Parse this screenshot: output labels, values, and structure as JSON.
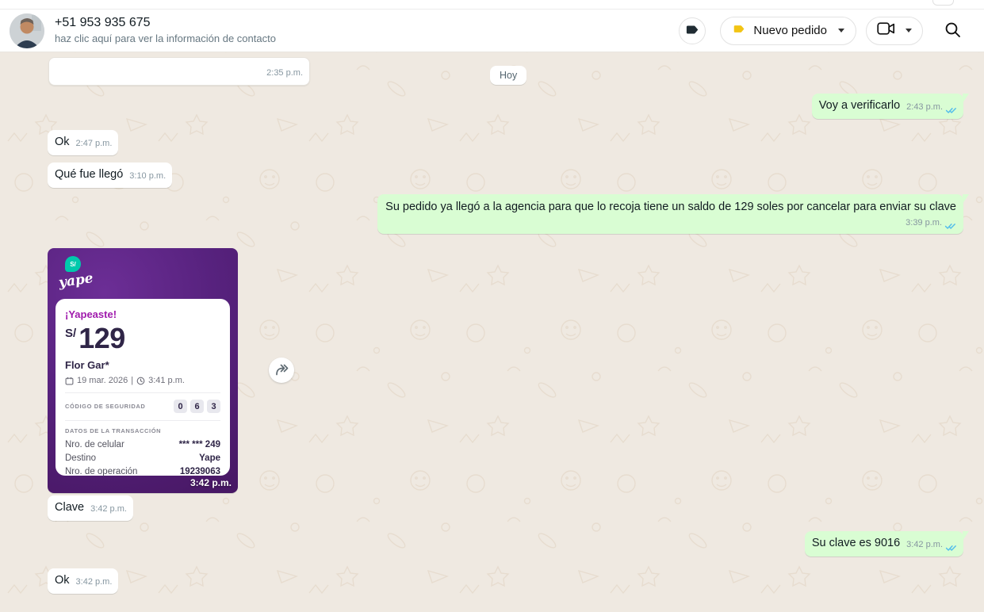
{
  "header": {
    "title": "+51 953 935 675",
    "subtitle": "haz clic aquí para ver la información de contacto",
    "status_button": {
      "label": "Nuevo pedido",
      "tag_color": "#f2c414"
    },
    "icons": [
      "tag-icon",
      "video-camera-icon",
      "chevron-down-icon",
      "search-icon"
    ]
  },
  "chat": {
    "date_divider": "Hoy",
    "messages": [
      {
        "direction": "in",
        "text": "",
        "time": "2:35 p.m."
      },
      {
        "direction": "out",
        "text": "Voy a verificarlo",
        "time": "2:43 p.m.",
        "status": "read"
      },
      {
        "direction": "in",
        "text": "Ok",
        "time": "2:47 p.m."
      },
      {
        "direction": "in",
        "text": "Qué fue llegó",
        "time": "3:10 p.m."
      },
      {
        "direction": "out",
        "text": "Su pedido ya llegó a la agencia para que lo recoja tiene un saldo de 129 soles por cancelar para enviar su clave",
        "time": "3:39 p.m.",
        "status": "read"
      },
      {
        "direction": "in",
        "type": "image-receipt",
        "time": "3:42 p.m."
      },
      {
        "direction": "in",
        "text": "Clave",
        "time": "3:42 p.m."
      },
      {
        "direction": "out",
        "text": "Su clave es 9016",
        "time": "3:42 p.m.",
        "status": "read"
      },
      {
        "direction": "in",
        "text": "Ok",
        "time": "3:42 p.m."
      }
    ]
  },
  "receipt": {
    "logo_currency": "S/",
    "logo_name": "yape",
    "title": "¡Yapeaste!",
    "currency": "S/",
    "amount": "129",
    "recipient": "Flor Gar*",
    "date": "19 mar. 2026",
    "separator": "|",
    "time": "3:41 p.m.",
    "security_label": "CÓDIGO DE SEGURIDAD",
    "security_code": [
      "0",
      "6",
      "3"
    ],
    "transaction_label": "DATOS DE LA TRANSACCIÓN",
    "rows": [
      {
        "label": "Nro. de celular",
        "value": "*** *** 249"
      },
      {
        "label": "Destino",
        "value": "Yape"
      },
      {
        "label": "Nro. de operación",
        "value": "19239063"
      }
    ]
  },
  "colors": {
    "outgoing_bubble": "#d9fdd3",
    "incoming_bubble": "#ffffff",
    "chat_background": "#efe9e1",
    "accent_yellow": "#f2c414",
    "read_tick_blue": "#53bdeb",
    "yape_purple": "#4a1a68",
    "yape_teal": "#00c9ac"
  }
}
